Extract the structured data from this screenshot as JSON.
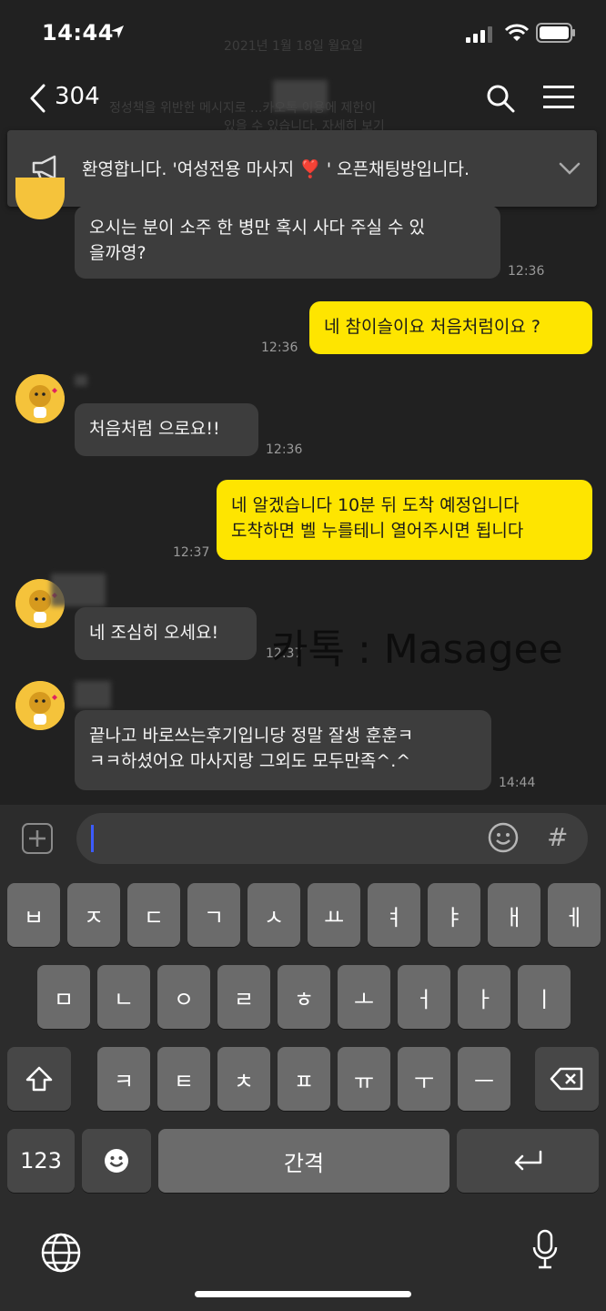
{
  "status_bar": {
    "time": "14:44"
  },
  "background_notice": {
    "date": "2021년 1월 18일 월요일",
    "line1": "정성책을 위반한 메시지로 ...카오톡 이용에 제한이",
    "line2": "있을 수 있습니다. 자세히 보기"
  },
  "header": {
    "title": "304"
  },
  "notice_banner": {
    "text_before": "환영합니다. '여성전용 마사지 ",
    "heart": "❣️",
    "text_after": " ' 오픈채팅방입니다."
  },
  "messages": [
    {
      "dir": "in",
      "lines": [
        "오시는 분이 소주 한 병만 혹시 사다 주실 수 있",
        "을까영?"
      ],
      "time": "12:36"
    },
    {
      "dir": "out",
      "lines": [
        "네 참이슬이요 처음처럼이요 ?"
      ],
      "time": "12:36"
    },
    {
      "dir": "in",
      "lines": [
        "처음처럼 으로요!!"
      ],
      "time": "12:36"
    },
    {
      "dir": "out",
      "lines": [
        "네 알겠습니다 10분 뒤 도착 예정입니다",
        "도착하면 벨 누를테니 열어주시면 됩니다"
      ],
      "time": "12:37"
    },
    {
      "dir": "in",
      "lines": [
        "네 조심히 오세요!"
      ],
      "time": "12:37"
    },
    {
      "dir": "in",
      "lines": [
        "끝나고 바로쓰는후기입니당 정말 잘생 훈훈ㅋ",
        "ㅋㅋ하셨어요 마사지랑 그외도 모두만족^.^"
      ],
      "time": "14:44"
    }
  ],
  "watermark": "카톡 : Masagee",
  "input": {
    "value": "",
    "hash": "#"
  },
  "keyboard": {
    "row1": [
      "ㅂ",
      "ㅈ",
      "ㄷ",
      "ㄱ",
      "ㅅ",
      "ㅛ",
      "ㅕ",
      "ㅑ",
      "ㅐ",
      "ㅔ"
    ],
    "row2": [
      "ㅁ",
      "ㄴ",
      "ㅇ",
      "ㄹ",
      "ㅎ",
      "ㅗ",
      "ㅓ",
      "ㅏ",
      "ㅣ"
    ],
    "row3": [
      "ㅋ",
      "ㅌ",
      "ㅊ",
      "ㅍ",
      "ㅠ",
      "ㅜ",
      "ㅡ"
    ],
    "numbers": "123",
    "space": "간격"
  },
  "colors": {
    "background": "#212121",
    "incoming_bubble": "#3d3d3d",
    "outgoing_bubble": "#fee500",
    "avatar": "#f5c33b"
  }
}
